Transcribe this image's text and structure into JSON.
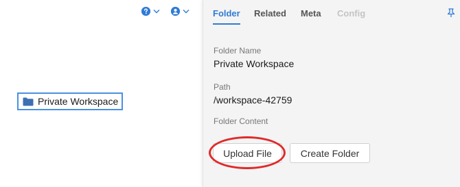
{
  "toolbar": {
    "help_icon": "question-circle-icon",
    "user_icon": "user-circle-icon",
    "accent_color": "#2f7bd6"
  },
  "canvas": {
    "folder_node": {
      "icon": "folder-icon",
      "label": "Private Workspace"
    }
  },
  "panel": {
    "tabs": [
      {
        "label": "Folder",
        "active": true
      },
      {
        "label": "Related",
        "active": false
      },
      {
        "label": "Meta",
        "active": false
      },
      {
        "label": "Config",
        "active": false,
        "disabled": true
      }
    ],
    "pin_icon": "pin-icon",
    "fields": {
      "folder_name": {
        "label": "Folder Name",
        "value": "Private Workspace"
      },
      "path": {
        "label": "Path",
        "value": "/workspace-42759"
      },
      "folder_content": {
        "label": "Folder Content"
      }
    },
    "buttons": {
      "upload": "Upload File",
      "create_folder": "Create Folder"
    }
  },
  "annotation": {
    "highlight_color": "#e02a2a"
  }
}
